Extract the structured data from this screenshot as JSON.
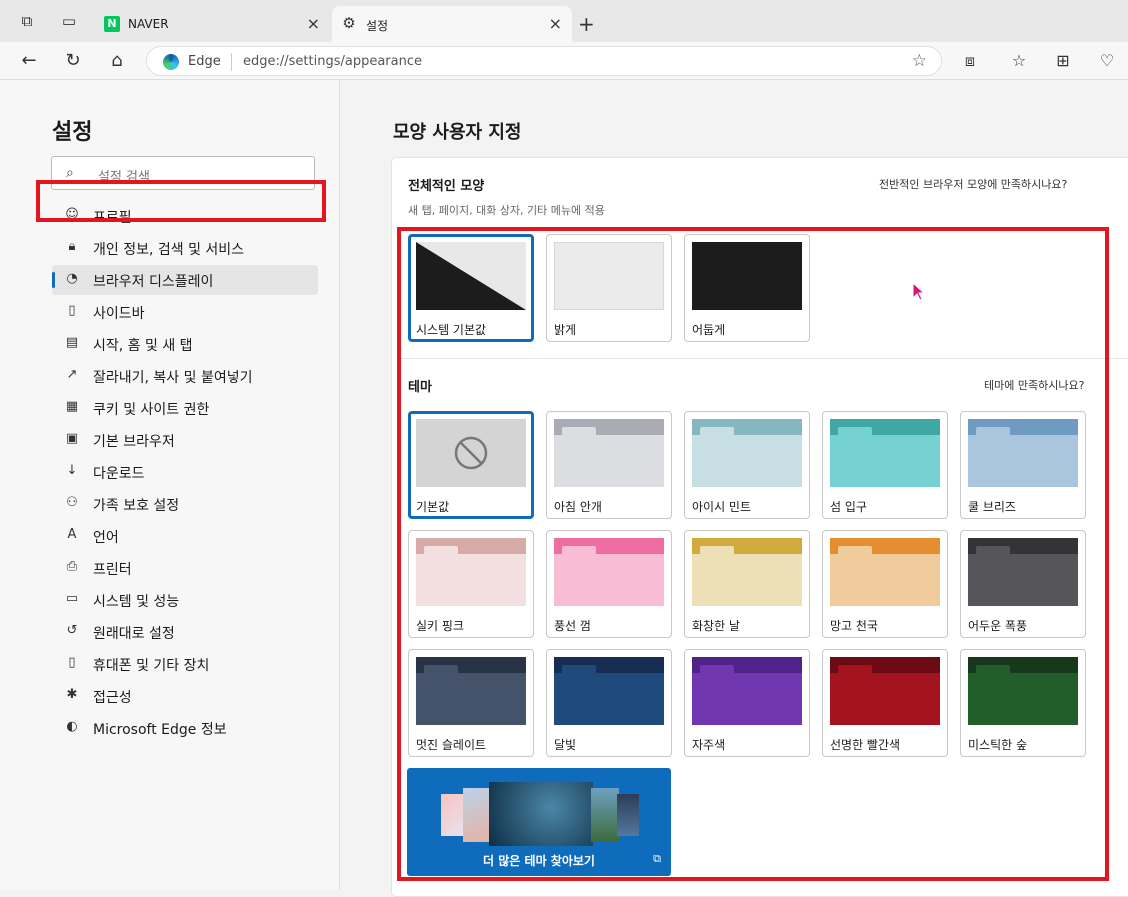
{
  "tabs": {
    "naver_label": "NAVER",
    "naver_logo": "N",
    "settings_label": "설정"
  },
  "address": {
    "edge_label": "Edge",
    "url": "edge://settings/appearance"
  },
  "sidebar": {
    "title": "설정",
    "search_placeholder": "설정 검색",
    "items": [
      {
        "label": "프로필",
        "icon": "profile-icon"
      },
      {
        "label": "개인 정보, 검색 및 서비스",
        "icon": "lock-icon"
      },
      {
        "label": "브라우저 디스플레이",
        "icon": "palette-icon"
      },
      {
        "label": "사이드바",
        "icon": "sidebar-icon"
      },
      {
        "label": "시작, 홈 및 새 탭",
        "icon": "start-icon"
      },
      {
        "label": "잘라내기, 복사 및 붙여넣기",
        "icon": "share-icon"
      },
      {
        "label": "쿠키 및 사이트 권한",
        "icon": "cookie-icon"
      },
      {
        "label": "기본 브라우저",
        "icon": "browser-icon"
      },
      {
        "label": "다운로드",
        "icon": "download-icon"
      },
      {
        "label": "가족 보호 설정",
        "icon": "family-icon"
      },
      {
        "label": "언어",
        "icon": "language-icon"
      },
      {
        "label": "프린터",
        "icon": "printer-icon"
      },
      {
        "label": "시스템 및 성능",
        "icon": "system-icon"
      },
      {
        "label": "원래대로 설정",
        "icon": "reset-icon"
      },
      {
        "label": "휴대폰 및 기타 장치",
        "icon": "phone-icon"
      },
      {
        "label": "접근성",
        "icon": "accessibility-icon"
      },
      {
        "label": "Microsoft Edge 정보",
        "icon": "edge-icon"
      }
    ]
  },
  "main": {
    "title": "모양 사용자 지정",
    "overall": {
      "title": "전체적인 모양",
      "subtitle": "새 탭, 페이지, 대화 상자, 기타 메뉴에 적용",
      "feedback": "전반적인 브라우저 모양에 만족하시나요?",
      "options": [
        {
          "label": "시스템 기본값",
          "selected": true
        },
        {
          "label": "밝게",
          "selected": false
        },
        {
          "label": "어둡게",
          "selected": false
        }
      ]
    },
    "theme": {
      "title": "테마",
      "feedback": "테마에 만족하시나요?",
      "items": [
        {
          "label": "기본값",
          "top": "#d4d4d4",
          "body": "#d4d4d4",
          "selected": true
        },
        {
          "label": "아침 안개",
          "top": "#a9adb3",
          "body": "#dcdde0"
        },
        {
          "label": "아이시 민트",
          "top": "#86b7be",
          "body": "#c7dfe2"
        },
        {
          "label": "섬 입구",
          "top": "#3fa8a4",
          "body": "#76d2d2"
        },
        {
          "label": "쿨 브리즈",
          "top": "#6f9bc2",
          "body": "#a9c6de"
        },
        {
          "label": "실키 핑크",
          "top": "#d6aaa6",
          "body": "#f1e0df"
        },
        {
          "label": "풍선 껌",
          "top": "#ee6ea4",
          "body": "#f8bcd4"
        },
        {
          "label": "화창한 날",
          "top": "#d2ab3e",
          "body": "#ede0b6"
        },
        {
          "label": "망고 천국",
          "top": "#e48d31",
          "body": "#f0cb9b"
        },
        {
          "label": "어두운 폭풍",
          "top": "#333438",
          "body": "#56565a"
        },
        {
          "label": "멋진 슬레이트",
          "top": "#283345",
          "body": "#44536a"
        },
        {
          "label": "달빛",
          "top": "#172d54",
          "body": "#1f4a7c"
        },
        {
          "label": "자주색",
          "top": "#4f2389",
          "body": "#7137b0"
        },
        {
          "label": "선명한 빨간색",
          "top": "#6d0b14",
          "body": "#a3141e"
        },
        {
          "label": "미스틱한 숲",
          "top": "#17381b",
          "body": "#225e2a"
        }
      ],
      "more_label": "더 많은 테마 찾아보기"
    }
  },
  "colors": {
    "accent": "#0f6cbd",
    "highlight": "#e3161f"
  }
}
